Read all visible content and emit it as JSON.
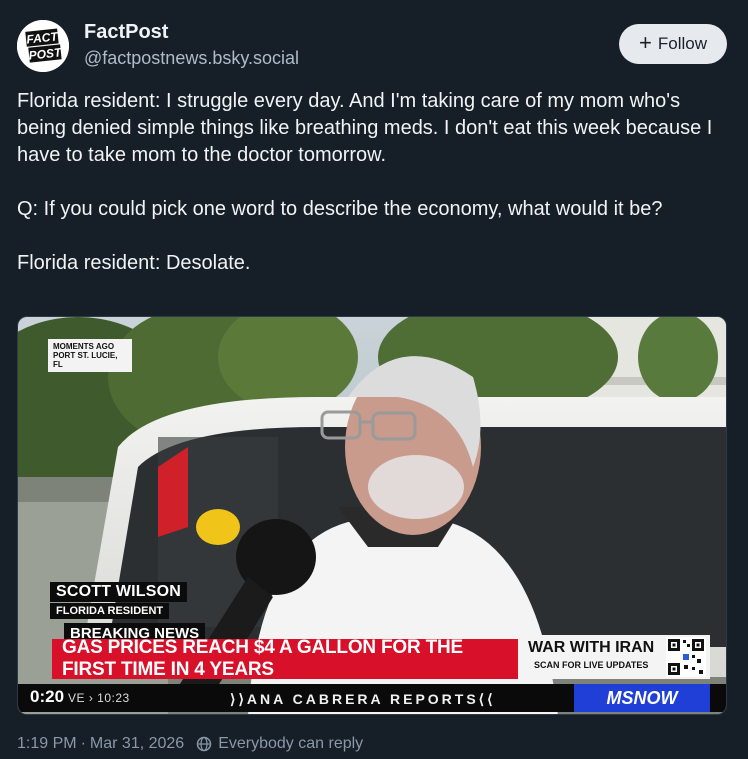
{
  "account": {
    "display_name": "FactPost",
    "handle": "@factpostnews.bsky.social",
    "avatar_line1": "FACT",
    "avatar_line2": "POST"
  },
  "follow_button": {
    "icon": "plus-icon",
    "label": "Follow"
  },
  "post": {
    "paragraphs": [
      "Florida resident: I struggle every day. And I'm taking care of my mom who's being denied simple things like breathing meds. I don't eat this week because I have to take mom to the doctor tomorrow.",
      "Q: If you could pick one word to describe the economy, what would it be?",
      "Florida resident: Desolate."
    ]
  },
  "video": {
    "location_tag_line1": "MOMENTS AGO",
    "location_tag_line2": "PORT ST. LUCIE, FL",
    "chyron_name": "SCOTT WILSON",
    "chyron_role": "FLORIDA RESIDENT",
    "breaking_label": "BREAKING NEWS",
    "headline": "GAS PRICES REACH $4 A GALLON FOR THE FIRST TIME IN 4 YEARS",
    "side_title": "WAR WITH IRAN",
    "side_subtitle": "SCAN FOR LIVE UPDATES",
    "timer": "0:20",
    "live_text": "VE › 10:23",
    "show_title": "⟩⟩ANA CABRERA REPORTS⟨⟨",
    "network": "MSNOW"
  },
  "meta": {
    "time": "1:19 PM",
    "separator": "·",
    "date": "Mar 31, 2026",
    "reply_setting": "Everybody can reply",
    "reply_icon": "globe-icon"
  },
  "colors": {
    "background": "#161e27",
    "headline_red": "#d8102a",
    "network_blue": "#1f3fd6",
    "muted_text": "#8a98a8"
  }
}
